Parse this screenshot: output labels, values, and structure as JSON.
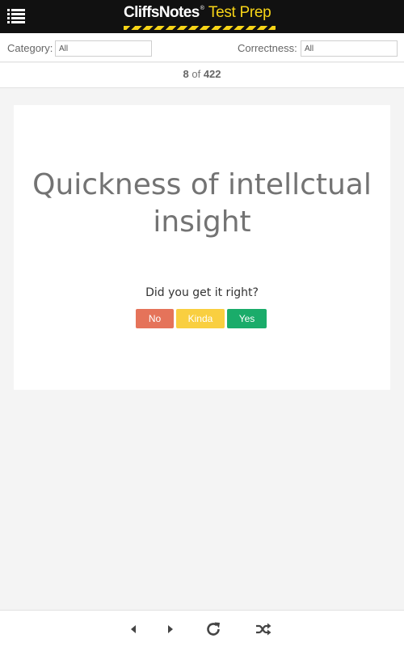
{
  "header": {
    "brand_main": "CliffsNotes",
    "brand_reg": "®",
    "brand_sub": "Test Prep",
    "menu_icon": "hamburger-menu-icon"
  },
  "filters": {
    "category_label": "Category:",
    "category_value": "All",
    "correctness_label": "Correctness:",
    "correctness_value": "All"
  },
  "counter": {
    "current": "8",
    "of": "of",
    "total": "422"
  },
  "card": {
    "term": "Quickness of intellctual insight",
    "question": "Did you get it right?",
    "buttons": {
      "no": "No",
      "kinda": "Kinda",
      "yes": "Yes"
    }
  },
  "colors": {
    "no": "#e5735a",
    "kinda": "#f9cf40",
    "yes": "#1aac6a",
    "brand_accent": "#f7d417"
  },
  "footer": {
    "icons": [
      "previous-icon",
      "next-icon",
      "refresh-icon",
      "shuffle-icon"
    ]
  }
}
